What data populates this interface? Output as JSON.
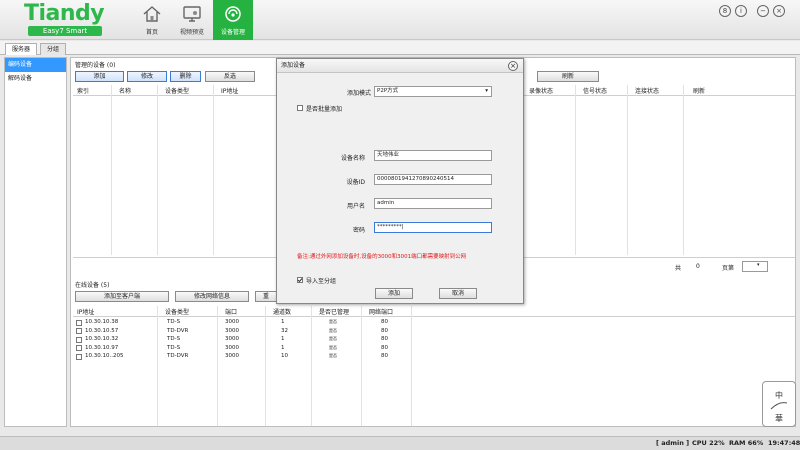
{
  "brand": {
    "name": "Tiandy",
    "slogan": "Easy7 Smart"
  },
  "nav": [
    {
      "label": "首页",
      "icon": "home-icon"
    },
    {
      "label": "视频预览",
      "icon": "video-preview-icon"
    },
    {
      "label": "设备管理",
      "icon": "device-manage-icon",
      "active": true
    }
  ],
  "window_controls": [
    "8",
    "i",
    "−",
    "×"
  ],
  "tabs": [
    {
      "label": "服务器",
      "active": true
    },
    {
      "label": "分组"
    }
  ],
  "left_panel": [
    {
      "label": "编码设备",
      "active": true
    },
    {
      "label": "解码设备"
    }
  ],
  "managed": {
    "title": "管理的设备 (0)",
    "buttons": [
      "添加",
      "修改",
      "删除",
      "反选"
    ],
    "refresh": "刷新",
    "columns_left": [
      "索引",
      "名称",
      "设备类型",
      "IP地址"
    ],
    "columns_right": [
      "录像状态",
      "信号状态",
      "连接状态",
      "刷新"
    ],
    "total_label": "共",
    "total_count": "0",
    "page_label": "页第"
  },
  "online": {
    "title": "在线设备 (5)",
    "buttons": [
      "添加至客户端",
      "修改网络信息",
      "重"
    ],
    "columns": [
      "IP地址",
      "设备类型",
      "端口",
      "通道数",
      "是否已管理",
      "网络端口"
    ],
    "rows": [
      {
        "ip": "10.30.10.38",
        "type": "TD-S",
        "port": "3000",
        "channels": "1",
        "managed": "是否",
        "net_port": "80"
      },
      {
        "ip": "10.30.10.57",
        "type": "TD-DVR",
        "port": "3000",
        "channels": "32",
        "managed": "是否",
        "net_port": "80"
      },
      {
        "ip": "10.30.10.32",
        "type": "TD-S",
        "port": "3000",
        "channels": "1",
        "managed": "是否",
        "net_port": "80"
      },
      {
        "ip": "10.30.10.97",
        "type": "TD-S",
        "port": "3000",
        "channels": "1",
        "managed": "是否",
        "net_port": "80"
      },
      {
        "ip": "10.30.10..205",
        "type": "TD-DVR",
        "port": "3000",
        "channels": "10",
        "managed": "是否",
        "net_port": "80"
      }
    ]
  },
  "dialog": {
    "title": "添加设备",
    "close": "×",
    "mode_label": "添加模式",
    "mode_value": "P2P方式",
    "batch_label": "是否批量添加",
    "name_label": "设备名称",
    "name_value": "天地伟业",
    "id_label": "设备ID",
    "id_value": "000080194127089024051​4",
    "user_label": "用户名",
    "user_value": "admin",
    "pwd_label": "密码",
    "pwd_value": "*********|",
    "note": "备注:通过外网添加设备时,设备的3000和3001端口都需要映射到公网",
    "import_label": "导入至分组",
    "add_button": "添加",
    "cancel_button": "取消"
  },
  "status": {
    "user": "[ admin ]",
    "cpu": "CPU  22%",
    "ram": "RAM  66%",
    "time": "19:47:48"
  },
  "corner_logo": {
    "top": "中",
    "bottom": "華"
  },
  "colors": {
    "brand_green": "#2eb84b",
    "active_nav": "#25b241",
    "selection_blue": "#3399ff",
    "note_red": "#e01818"
  }
}
